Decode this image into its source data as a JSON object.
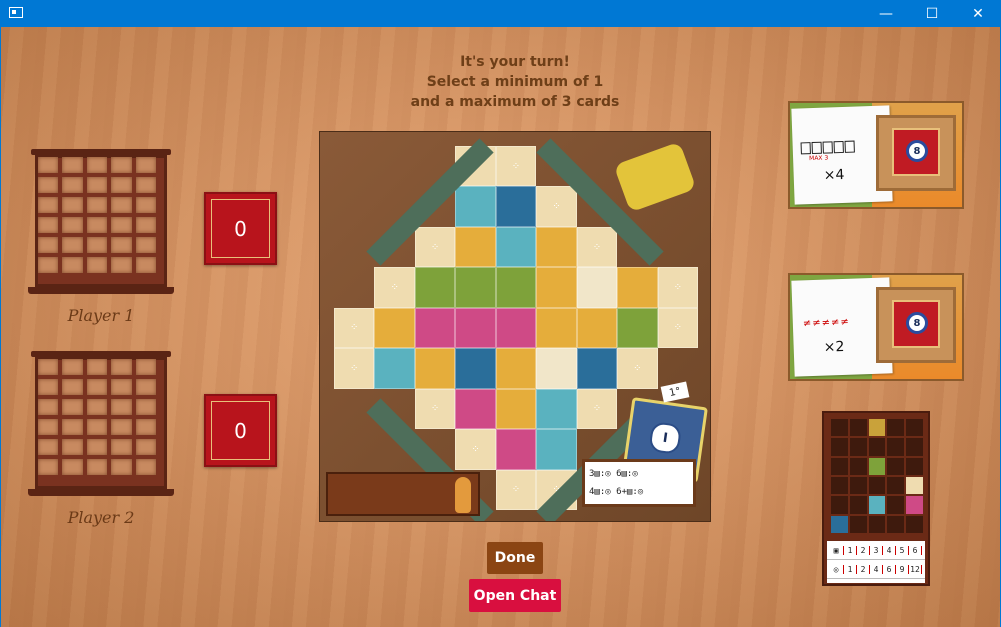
{
  "window": {
    "minimize_glyph": "—",
    "maximize_glyph": "☐",
    "close_glyph": "✕"
  },
  "turn_message": {
    "line1": "It's your turn!",
    "line2": "Select a minimum of 1",
    "line3": "and a maximum of 3 cards"
  },
  "players": [
    {
      "name": "Player 1",
      "score": "0"
    },
    {
      "name": "Player 2",
      "score": "0"
    }
  ],
  "board": {
    "first_token_label": "1°",
    "ribbon_label": "I",
    "scoring_note": {
      "row1": "3▤:◎  6▤:◎",
      "row2": "4▤:◎  6+▤:◎"
    }
  },
  "common_goals": [
    {
      "rule": "MAX 3",
      "multiplier": "×4",
      "points": "8"
    },
    {
      "rule": "≠≠≠≠≠",
      "multiplier": "×2",
      "points": "8"
    }
  ],
  "personal_goal": {
    "row1": [
      "1",
      "2",
      "3",
      "4",
      "5",
      "6"
    ],
    "row2": [
      "1",
      "2",
      "4",
      "6",
      "9",
      "12"
    ]
  },
  "buttons": {
    "done": "Done",
    "open_chat": "Open Chat"
  },
  "colors": {
    "done": "#8b4513",
    "chat": "#d90f3f",
    "score_card": "#b8141c",
    "titlebar": "#0078d4"
  }
}
